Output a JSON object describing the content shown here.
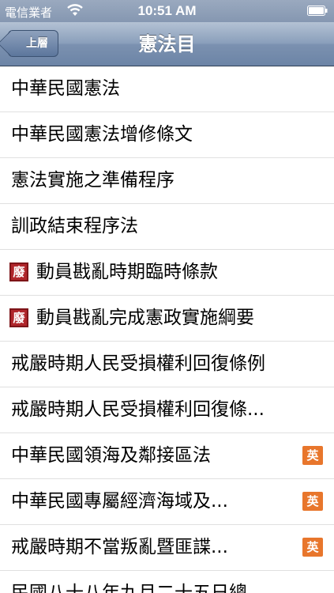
{
  "status_bar": {
    "carrier": "電信業者",
    "time": "10:51 AM",
    "wifi_icon": "wifi-icon",
    "battery_icon": "battery-icon"
  },
  "nav_bar": {
    "back_label": "上層",
    "title": "憲法目"
  },
  "badges": {
    "abolished": "廢",
    "english": "英"
  },
  "list": {
    "items": [
      {
        "label": "中華民國憲法"
      },
      {
        "label": "中華民國憲法增修條文"
      },
      {
        "label": "憲法實施之準備程序"
      },
      {
        "label": "訓政結束程序法"
      },
      {
        "label": "動員戡亂時期臨時條款"
      },
      {
        "label": "動員戡亂完成憲政實施綱要"
      },
      {
        "label": "戒嚴時期人民受損權利回復條例"
      },
      {
        "label": "戒嚴時期人民受損權利回復條..."
      },
      {
        "label": "中華民國領海及鄰接區法"
      },
      {
        "label": "中華民國專屬經濟海域及..."
      },
      {
        "label": "戒嚴時期不當叛亂暨匪諜..."
      },
      {
        "label": "民國八十八年九月二十五日總"
      }
    ]
  }
}
